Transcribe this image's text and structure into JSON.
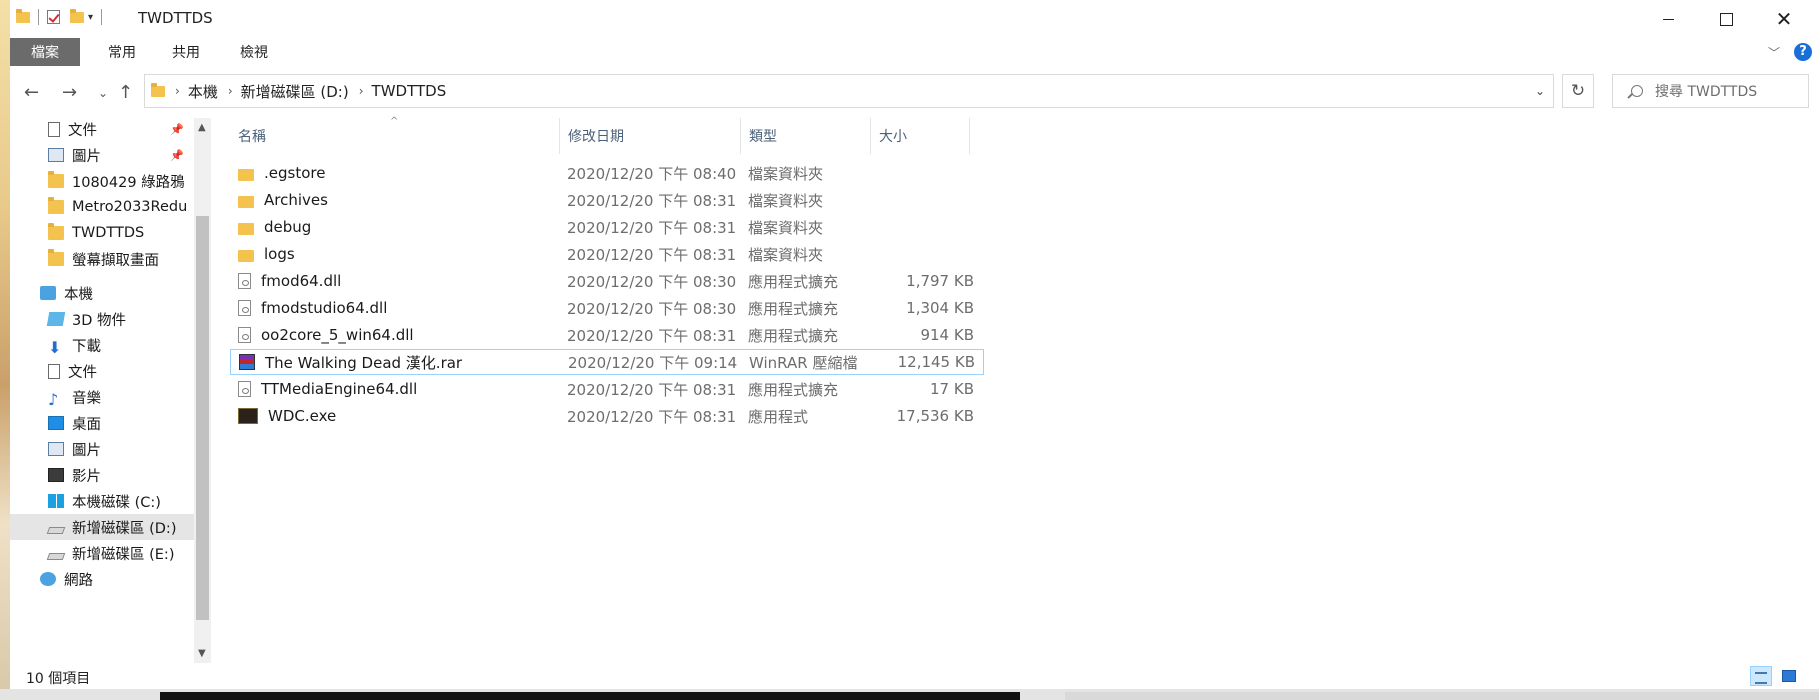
{
  "window": {
    "title": "TWDTTDS"
  },
  "ribbon": {
    "tabs": [
      "檔案",
      "常用",
      "共用",
      "檢視"
    ]
  },
  "address": {
    "crumbs": [
      "本機",
      "新增磁碟區 (D:)",
      "TWDTTDS"
    ],
    "search_placeholder": "搜尋 TWDTTDS"
  },
  "nav": {
    "items": [
      {
        "label": "文件",
        "icon": "documents-icon",
        "pinned": true
      },
      {
        "label": "圖片",
        "icon": "pictures-icon",
        "pinned": true
      },
      {
        "label": "1080429 綠路鴉",
        "icon": "folder-icon"
      },
      {
        "label": "Metro2033Redu",
        "icon": "folder-icon"
      },
      {
        "label": "TWDTTDS",
        "icon": "folder-icon"
      },
      {
        "label": "螢幕擷取畫面",
        "icon": "folder-icon"
      },
      {
        "label": "本機",
        "icon": "this-pc-icon"
      },
      {
        "label": "3D 物件",
        "icon": "3d-objects-icon"
      },
      {
        "label": "下載",
        "icon": "downloads-icon"
      },
      {
        "label": "文件",
        "icon": "documents-icon"
      },
      {
        "label": "音樂",
        "icon": "music-icon"
      },
      {
        "label": "桌面",
        "icon": "desktop-icon"
      },
      {
        "label": "圖片",
        "icon": "pictures-icon"
      },
      {
        "label": "影片",
        "icon": "videos-icon"
      },
      {
        "label": "本機磁碟 (C:)",
        "icon": "windows-drive-icon"
      },
      {
        "label": "新增磁碟區 (D:)",
        "icon": "drive-icon"
      },
      {
        "label": "新增磁碟區 (E:)",
        "icon": "drive-icon"
      },
      {
        "label": "網路",
        "icon": "network-icon"
      }
    ]
  },
  "columns": {
    "name": "名稱",
    "date": "修改日期",
    "type": "類型",
    "size": "大小"
  },
  "files": [
    {
      "name": ".egstore",
      "date": "2020/12/20 下午 08:40",
      "type": "檔案資料夾",
      "size": "",
      "icon": "folder-icon"
    },
    {
      "name": "Archives",
      "date": "2020/12/20 下午 08:31",
      "type": "檔案資料夾",
      "size": "",
      "icon": "folder-icon"
    },
    {
      "name": "debug",
      "date": "2020/12/20 下午 08:31",
      "type": "檔案資料夾",
      "size": "",
      "icon": "folder-icon"
    },
    {
      "name": "logs",
      "date": "2020/12/20 下午 08:31",
      "type": "檔案資料夾",
      "size": "",
      "icon": "folder-icon"
    },
    {
      "name": "fmod64.dll",
      "date": "2020/12/20 下午 08:30",
      "type": "應用程式擴充",
      "size": "1,797 KB",
      "icon": "dll-icon"
    },
    {
      "name": "fmodstudio64.dll",
      "date": "2020/12/20 下午 08:30",
      "type": "應用程式擴充",
      "size": "1,304 KB",
      "icon": "dll-icon"
    },
    {
      "name": "oo2core_5_win64.dll",
      "date": "2020/12/20 下午 08:31",
      "type": "應用程式擴充",
      "size": "914 KB",
      "icon": "dll-icon"
    },
    {
      "name": "The Walking Dead 漢化.rar",
      "date": "2020/12/20 下午 09:14",
      "type": "WinRAR 壓縮檔",
      "size": "12,145 KB",
      "icon": "rar-icon"
    },
    {
      "name": "TTMediaEngine64.dll",
      "date": "2020/12/20 下午 08:31",
      "type": "應用程式擴充",
      "size": "17 KB",
      "icon": "dll-icon"
    },
    {
      "name": "WDC.exe",
      "date": "2020/12/20 下午 08:31",
      "type": "應用程式",
      "size": "17,536 KB",
      "icon": "exe-icon"
    }
  ],
  "status": {
    "count": "10 個項目"
  }
}
